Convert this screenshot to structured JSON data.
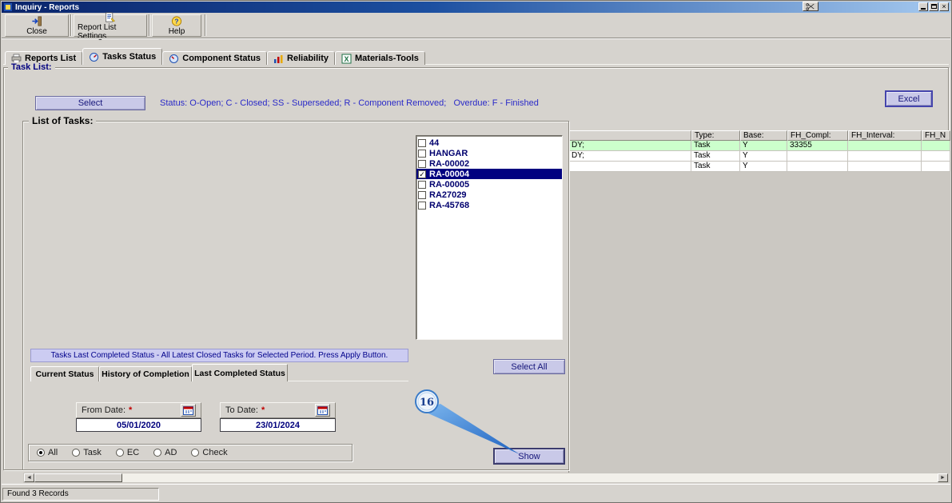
{
  "window": {
    "title": "Inquiry - Reports",
    "status_bar": "Found 3 Records"
  },
  "icons": {
    "close_x": "×",
    "check": "✓",
    "scroll_left": "◄",
    "scroll_right": "►",
    "question": "?",
    "excel_x": "X"
  },
  "toolbar": {
    "close": "Close",
    "report_list_settings": "Report List Settings",
    "help": "Help"
  },
  "main_tabs": [
    {
      "label": "Reports List",
      "active": false
    },
    {
      "label": "Tasks Status",
      "active": true
    },
    {
      "label": "Component Status",
      "active": false
    },
    {
      "label": "Reliability",
      "active": false
    },
    {
      "label": "Materials-Tools",
      "active": false
    }
  ],
  "task_list": {
    "group_label": "Task List:",
    "select_button": "Select",
    "status_legend": "Status: O-Open; C - Closed; SS - Superseded; R - Component Removed;   Overdue: F - Finished",
    "excel_button": "Excel"
  },
  "grid": {
    "columns": [
      "",
      "Type:",
      "Base:",
      "FH_Compl:",
      "FH_Interval:",
      "FH_N"
    ],
    "rows": [
      {
        "c0": "DY;",
        "type": "Task",
        "base": "Y",
        "fh_compl": "33355",
        "fh_interval": "",
        "fh_n": "",
        "highlighted": true
      },
      {
        "c0": "DY;",
        "type": "Task",
        "base": "Y",
        "fh_compl": "",
        "fh_interval": "",
        "fh_n": "",
        "highlighted": false
      },
      {
        "c0": "",
        "type": "Task",
        "base": "Y",
        "fh_compl": "",
        "fh_interval": "",
        "fh_n": "",
        "highlighted": false
      }
    ]
  },
  "list_of_tasks": {
    "group_label": "List of Tasks:",
    "select_all_button": "Select All",
    "items": [
      {
        "label": "44",
        "checked": false,
        "selected": false
      },
      {
        "label": "HANGAR",
        "checked": false,
        "selected": false
      },
      {
        "label": "RA-00002",
        "checked": false,
        "selected": false
      },
      {
        "label": "RA-00004",
        "checked": true,
        "selected": true
      },
      {
        "label": "RA-00005",
        "checked": false,
        "selected": false
      },
      {
        "label": "RA27029",
        "checked": false,
        "selected": false
      },
      {
        "label": "RA-45768",
        "checked": false,
        "selected": false
      }
    ]
  },
  "status_section": {
    "note": "Tasks Last Completed Status - All Latest Closed Tasks for Selected Period. Press Apply Button.",
    "tabs": [
      {
        "label": "Current Status",
        "active": false
      },
      {
        "label": "History of Completion",
        "active": false
      },
      {
        "label": "Last Completed Status",
        "active": true
      }
    ]
  },
  "filters": {
    "from_date": {
      "label": "From Date:",
      "required": "*",
      "value": "05/01/2020"
    },
    "to_date": {
      "label": "To Date:",
      "required": "*",
      "value": "23/01/2024"
    },
    "type_options": [
      {
        "label": "All",
        "selected": true
      },
      {
        "label": "Task",
        "selected": false
      },
      {
        "label": "EC",
        "selected": false
      },
      {
        "label": "AD",
        "selected": false
      },
      {
        "label": "Check",
        "selected": false
      }
    ],
    "show_button": "Show"
  },
  "callout": {
    "number": "16"
  },
  "colors": {
    "button_face": "#d6d3ce",
    "accent_button": "#c9c9e8",
    "selection": "#000080",
    "row_highlight": "#ccffcc",
    "legend_text": "#2a2ac8",
    "titlebar_start": "#0a246a",
    "titlebar_end": "#a6caf0"
  }
}
